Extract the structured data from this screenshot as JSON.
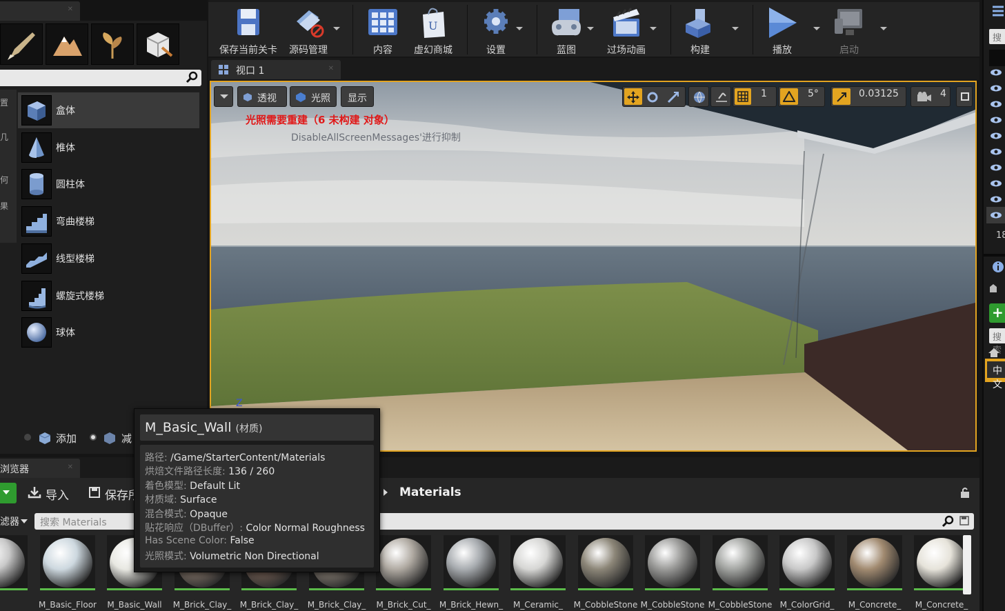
{
  "modes_panel": {
    "search_placeholder": "",
    "items": [
      {
        "label": "盒体"
      },
      {
        "label": "椎体"
      },
      {
        "label": "圆柱体"
      },
      {
        "label": "弯曲楼梯"
      },
      {
        "label": "线型楼梯"
      },
      {
        "label": "螺旋式楼梯"
      },
      {
        "label": "球体"
      }
    ],
    "strip_chars": [
      "置",
      "几",
      "何",
      "果"
    ],
    "add_label": "添加",
    "subtract_label": "减"
  },
  "toolbar": {
    "buttons": [
      {
        "label": "保存当前关卡"
      },
      {
        "label": "源码管理"
      },
      {
        "label": "内容"
      },
      {
        "label": "虚幻商城"
      },
      {
        "label": "设置"
      },
      {
        "label": "蓝图"
      },
      {
        "label": "过场动画"
      },
      {
        "label": "构建"
      },
      {
        "label": "播放"
      },
      {
        "label": "启动"
      }
    ]
  },
  "viewport": {
    "tab_label": "视口 1",
    "perspective_label": "透视",
    "lighting_label": "光照",
    "show_label": "显示",
    "grid_value": "1",
    "rotation_value": "5°",
    "scale_value": "0.03125",
    "camera_speed": "4",
    "warning": "光照需要重建（6 未构建 对象）",
    "warning_sub": "DisableAllScreenMessages'进行抑制",
    "axis_label": "Z"
  },
  "outliner": {
    "search_label": "搜",
    "count_label": "18",
    "search_label_2": "搜索",
    "lang_label": "中文"
  },
  "content_browser": {
    "tab_label": "浏览器",
    "import_label": "导入",
    "save_label": "保存所有",
    "path_label": "Materials",
    "filters_label": "滤器",
    "search_placeholder": "搜索 Materials",
    "assets": [
      {
        "name": "",
        "color": "#c9c9c9"
      },
      {
        "name": "M_Basic_Floor",
        "color": "#cdd8df"
      },
      {
        "name": "M_Basic_Wall",
        "color": "#e8e8e2"
      },
      {
        "name": "M_Brick_Clay_",
        "color": "#8a7a6e"
      },
      {
        "name": "M_Brick_Clay_",
        "color": "#7a6458"
      },
      {
        "name": "M_Brick_Clay_",
        "color": "#8f857a"
      },
      {
        "name": "M_Brick_Cut_",
        "color": "#b0aaa2"
      },
      {
        "name": "M_Brick_Hewn_",
        "color": "#a8acb0"
      },
      {
        "name": "M_Ceramic_",
        "color": "#d6d6d4"
      },
      {
        "name": "M_CobbleStone",
        "color": "#8c8678"
      },
      {
        "name": "M_CobbleStone",
        "color": "#9a9a98"
      },
      {
        "name": "M_CobbleStone",
        "color": "#a3a5a2"
      },
      {
        "name": "M_ColorGrid_",
        "color": "#c8c8c8"
      },
      {
        "name": "M_Concrete_",
        "color": "#a18a70"
      },
      {
        "name": "M_Concrete_",
        "color": "#e6e3da"
      }
    ]
  },
  "tooltip": {
    "title": "M_Basic_Wall",
    "type": "(材质)",
    "rows": [
      {
        "k": "路径: ",
        "v": "/Game/StarterContent/Materials"
      },
      {
        "k": "烘焙文件路径长度: ",
        "v": "136 / 260"
      },
      {
        "k": "着色模型: ",
        "v": "Default Lit"
      },
      {
        "k": "材质域: ",
        "v": "Surface"
      },
      {
        "k": "混合模式: ",
        "v": "Opaque"
      },
      {
        "k": "贴花响应（DBuffer）: ",
        "v": "Color Normal Roughness"
      },
      {
        "k": "Has Scene Color: ",
        "v": "False"
      },
      {
        "k": "光照模式: ",
        "v": "Volumetric Non Directional"
      }
    ]
  }
}
